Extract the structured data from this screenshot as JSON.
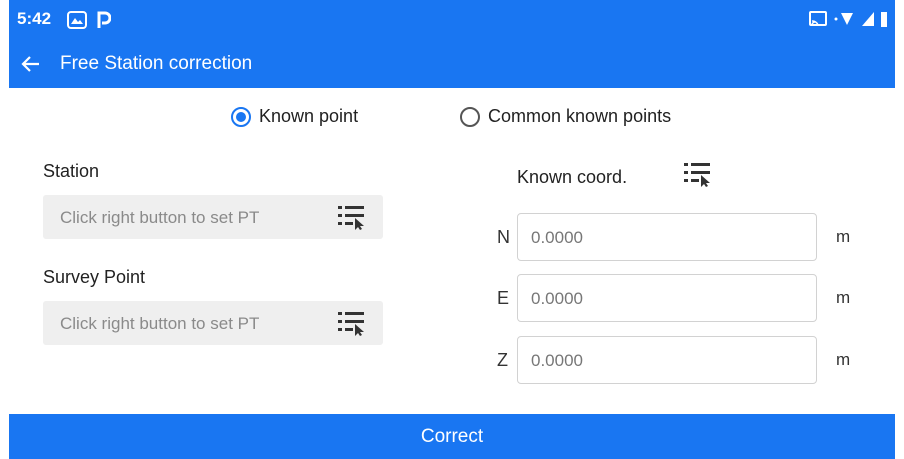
{
  "status_bar": {
    "time": "5:42",
    "icons": [
      "photos-icon",
      "parking-app-icon",
      "cast-icon",
      "wifi-icon",
      "signal-icon",
      "battery-icon"
    ]
  },
  "app_bar": {
    "title": "Free Station correction",
    "back_icon": "arrow-left-icon"
  },
  "mode": {
    "options": [
      {
        "label": "Known point",
        "selected": true
      },
      {
        "label": "Common known points",
        "selected": false
      }
    ]
  },
  "station": {
    "label": "Station",
    "placeholder": "Click right button to set PT"
  },
  "survey_point": {
    "label": "Survey Point",
    "placeholder": "Click right button to set PT"
  },
  "known_coord": {
    "label": "Known coord.",
    "rows": [
      {
        "axis": "N",
        "value": "0.0000",
        "unit": "m"
      },
      {
        "axis": "E",
        "value": "0.0000",
        "unit": "m"
      },
      {
        "axis": "Z",
        "value": "0.0000",
        "unit": "m"
      }
    ]
  },
  "actions": {
    "correct_label": "Correct"
  },
  "colors": {
    "primary": "#1976f2",
    "field_bg": "#efefef",
    "placeholder": "#8a8a8a"
  }
}
